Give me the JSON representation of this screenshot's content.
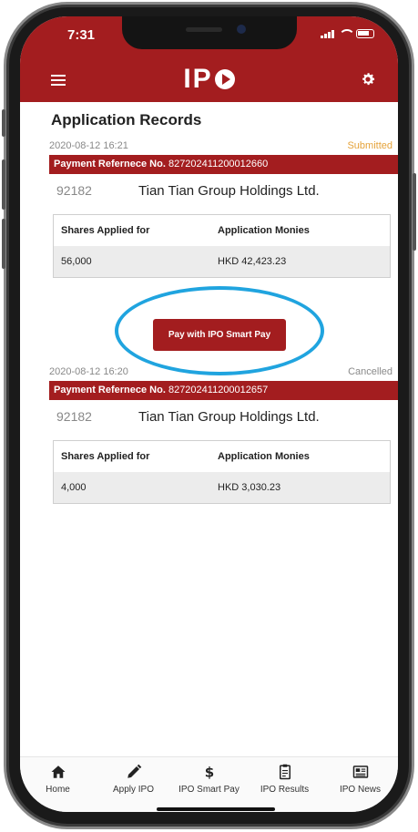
{
  "status_bar": {
    "time": "7:31"
  },
  "header": {
    "logo_text": "IP",
    "brand_color": "#a31d1f"
  },
  "page": {
    "title": "Application Records"
  },
  "records": [
    {
      "date": "2020-08-12 16:21",
      "status": "Submitted",
      "ref_label": "Payment Refernece No.",
      "ref_no": "827202411200012660",
      "stock_code": "92182",
      "company": "Tian Tian Group Holdings Ltd.",
      "col1_header": "Shares Applied for",
      "col2_header": "Application Monies",
      "shares": "56,000",
      "monies": "HKD 42,423.23"
    },
    {
      "date": "2020-08-12 16:20",
      "status": "Cancelled",
      "ref_label": "Payment Refernece No.",
      "ref_no": "827202411200012657",
      "stock_code": "92182",
      "company": "Tian Tian Group Holdings Ltd.",
      "col1_header": "Shares Applied for",
      "col2_header": "Application Monies",
      "shares": "4,000",
      "monies": "HKD 3,030.23"
    }
  ],
  "pay_button": {
    "label": "Pay with IPO Smart Pay"
  },
  "tabbar": [
    {
      "label": "Home",
      "icon": "home-icon"
    },
    {
      "label": "Apply IPO",
      "icon": "pencil-icon"
    },
    {
      "label": "IPO Smart Pay",
      "icon": "dollar-icon"
    },
    {
      "label": "IPO Results",
      "icon": "clipboard-icon"
    },
    {
      "label": "IPO News",
      "icon": "newspaper-icon"
    }
  ],
  "colors": {
    "submitted": "#e5a33b",
    "highlight_ring": "#20a4df"
  }
}
